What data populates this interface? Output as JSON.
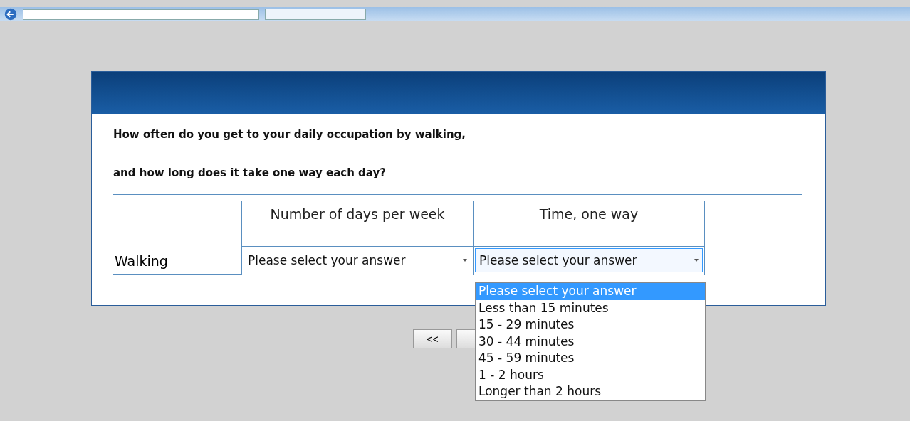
{
  "question": {
    "lines": [
      "How often do you get to your daily occupation by walking,",
      "and how long does it take one way each day?"
    ]
  },
  "table": {
    "columns": [
      "Number of days per week",
      "Time, one way"
    ],
    "rows": [
      {
        "label": "Walking",
        "selects": [
          {
            "value": "Please select your answer",
            "expanded": false
          },
          {
            "value": "Please select your answer",
            "expanded": true
          }
        ]
      }
    ]
  },
  "dropdown": {
    "options": [
      {
        "label": "Please select your answer",
        "selected": true
      },
      {
        "label": "Less than 15 minutes",
        "selected": false
      },
      {
        "label": "15 - 29 minutes",
        "selected": false
      },
      {
        "label": "30 - 44 minutes",
        "selected": false
      },
      {
        "label": "45 - 59 minutes",
        "selected": false
      },
      {
        "label": "1 - 2 hours",
        "selected": false
      },
      {
        "label": "Longer than 2 hours",
        "selected": false
      }
    ]
  },
  "navigation": {
    "back_button": "<<"
  }
}
